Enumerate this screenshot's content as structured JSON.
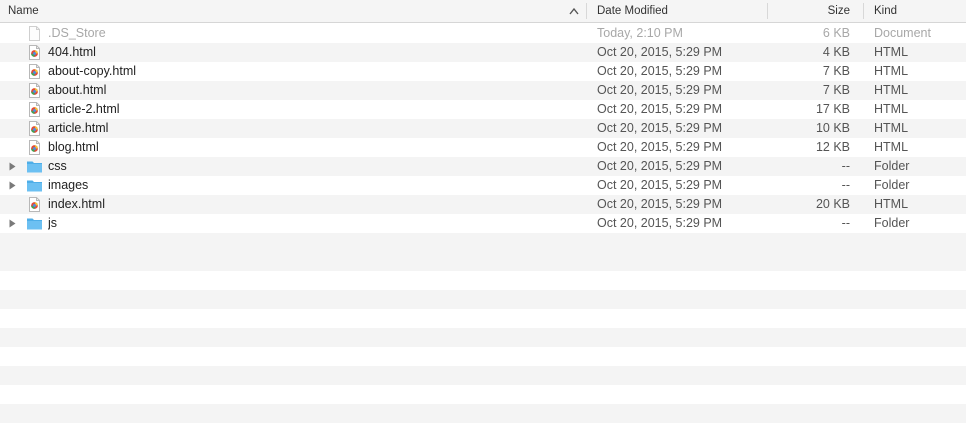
{
  "columns": {
    "name": "Name",
    "date_modified": "Date Modified",
    "size": "Size",
    "kind": "Kind"
  },
  "files": [
    {
      "name": ".DS_Store",
      "date": "Today, 2:10 PM",
      "size": "6 KB",
      "kind": "Document",
      "icon": "document-icon"
    },
    {
      "name": "404.html",
      "date": "Oct 20, 2015, 5:29 PM",
      "size": "4 KB",
      "kind": "HTML",
      "icon": "html-file-icon"
    },
    {
      "name": "about-copy.html",
      "date": "Oct 20, 2015, 5:29 PM",
      "size": "7 KB",
      "kind": "HTML",
      "icon": "html-file-icon"
    },
    {
      "name": "about.html",
      "date": "Oct 20, 2015, 5:29 PM",
      "size": "7 KB",
      "kind": "HTML",
      "icon": "html-file-icon"
    },
    {
      "name": "article-2.html",
      "date": "Oct 20, 2015, 5:29 PM",
      "size": "17 KB",
      "kind": "HTML",
      "icon": "html-file-icon"
    },
    {
      "name": "article.html",
      "date": "Oct 20, 2015, 5:29 PM",
      "size": "10 KB",
      "kind": "HTML",
      "icon": "html-file-icon"
    },
    {
      "name": "blog.html",
      "date": "Oct 20, 2015, 5:29 PM",
      "size": "12 KB",
      "kind": "HTML",
      "icon": "html-file-icon"
    },
    {
      "name": "css",
      "date": "Oct 20, 2015, 5:29 PM",
      "size": "--",
      "kind": "Folder",
      "icon": "folder-icon"
    },
    {
      "name": "images",
      "date": "Oct 20, 2015, 5:29 PM",
      "size": "--",
      "kind": "Folder",
      "icon": "folder-icon"
    },
    {
      "name": "index.html",
      "date": "Oct 20, 2015, 5:29 PM",
      "size": "20 KB",
      "kind": "HTML",
      "icon": "html-file-icon"
    },
    {
      "name": "js",
      "date": "Oct 20, 2015, 5:29 PM",
      "size": "--",
      "kind": "Folder",
      "icon": "folder-icon"
    }
  ],
  "colors": {
    "folder": "#5fb8ec",
    "alternate_row": "#f4f4f4",
    "header_bg": "#f5f5f5"
  }
}
